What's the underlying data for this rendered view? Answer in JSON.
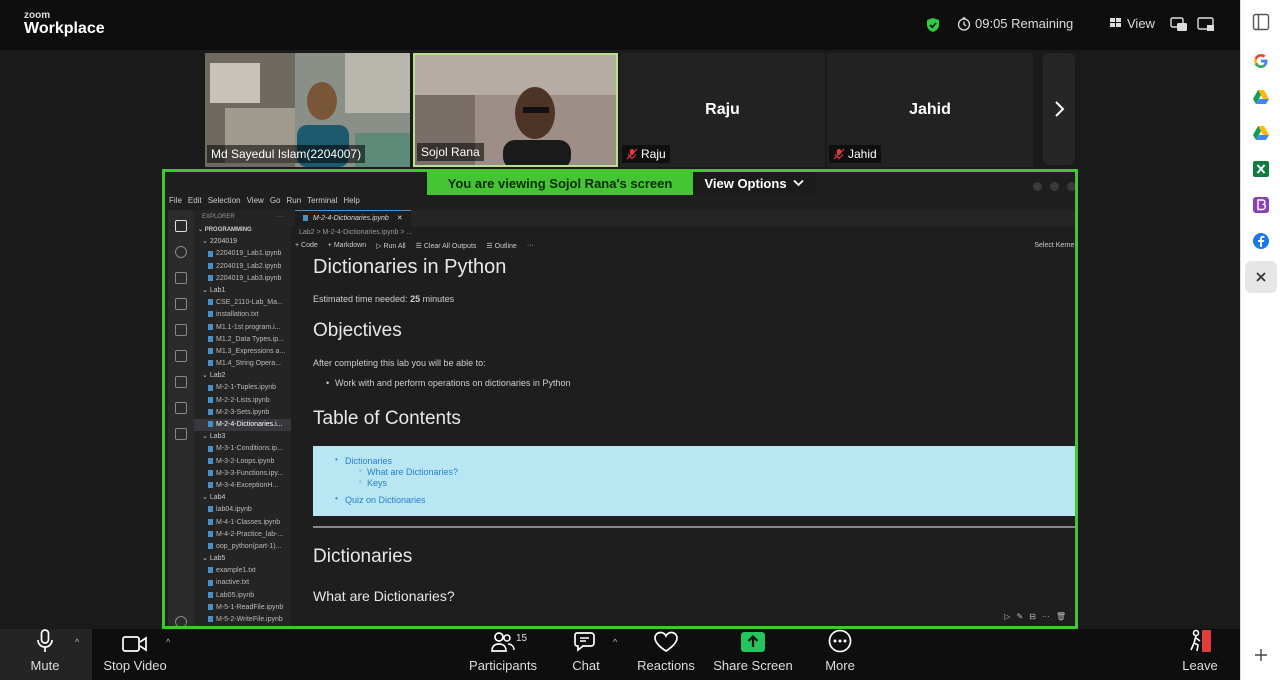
{
  "app": {
    "logo_small": "zoom",
    "logo_big": "Workplace"
  },
  "topbar": {
    "timer": "09:05 Remaining",
    "view_label": "View"
  },
  "participants": [
    {
      "name": "Md Sayedul Islam(2204007)"
    },
    {
      "name": "Sojol Rana"
    },
    {
      "name": "Raju",
      "display": "Raju"
    },
    {
      "name": "Jahid",
      "display": "Jahid"
    }
  ],
  "share": {
    "banner": "You are viewing  Sojol Rana's screen",
    "view_options": "View Options"
  },
  "vscode": {
    "menu": [
      "File",
      "Edit",
      "Selection",
      "View",
      "Go",
      "Run",
      "Terminal",
      "Help"
    ],
    "explorer_title": "EXPLORER",
    "explorer_more": "···",
    "workspace": "PROGRAMMING",
    "tree": [
      {
        "label": "2204019",
        "type": "folder",
        "indent": 1
      },
      {
        "label": "2204019_Lab1.ipynb",
        "type": "file",
        "indent": 2
      },
      {
        "label": "2204019_Lab2.ipynb",
        "type": "file",
        "indent": 2
      },
      {
        "label": "2204019_Lab3.ipynb",
        "type": "file",
        "indent": 2
      },
      {
        "label": "Lab1",
        "type": "folder",
        "indent": 1
      },
      {
        "label": "CSE_2110-Lab_Ma...",
        "type": "file",
        "indent": 2
      },
      {
        "label": "installation.txt",
        "type": "file",
        "indent": 2
      },
      {
        "label": "M1.1-1st program.i...",
        "type": "file",
        "indent": 2
      },
      {
        "label": "M1.2_Data Types.ip...",
        "type": "file",
        "indent": 2
      },
      {
        "label": "M1.3_Expressions a...",
        "type": "file",
        "indent": 2
      },
      {
        "label": "M1.4_String Opera...",
        "type": "file",
        "indent": 2
      },
      {
        "label": "Lab2",
        "type": "folder",
        "indent": 1
      },
      {
        "label": "M-2-1-Tuples.ipynb",
        "type": "file",
        "indent": 2
      },
      {
        "label": "M-2-2-Lists.ipynb",
        "type": "file",
        "indent": 2
      },
      {
        "label": "M-2-3-Sets.ipynb",
        "type": "file",
        "indent": 2
      },
      {
        "label": "M-2-4-Dictionaries.i...",
        "type": "file",
        "indent": 2,
        "selected": true
      },
      {
        "label": "Lab3",
        "type": "folder",
        "indent": 1
      },
      {
        "label": "M-3-1-Conditions.ip...",
        "type": "file",
        "indent": 2
      },
      {
        "label": "M-3-2-Loops.ipynb",
        "type": "file",
        "indent": 2
      },
      {
        "label": "M-3-3-Functions.ipy...",
        "type": "file",
        "indent": 2
      },
      {
        "label": "M-3-4-ExceptionH...",
        "type": "file",
        "indent": 2
      },
      {
        "label": "Lab4",
        "type": "folder",
        "indent": 1
      },
      {
        "label": "lab04.ipynb",
        "type": "file",
        "indent": 2
      },
      {
        "label": "M-4-1-Classes.ipynb",
        "type": "file",
        "indent": 2
      },
      {
        "label": "M-4-2-Practice_lab-...",
        "type": "file",
        "indent": 2
      },
      {
        "label": "oop_python(part-1)...",
        "type": "file",
        "indent": 2
      },
      {
        "label": "Lab5",
        "type": "folder",
        "indent": 1
      },
      {
        "label": "example1.txt",
        "type": "file",
        "indent": 2
      },
      {
        "label": "inactive.txt",
        "type": "file",
        "indent": 2
      },
      {
        "label": "Lab05.ipynb",
        "type": "file",
        "indent": 2
      },
      {
        "label": "M-5-1-ReadFile.ipynb",
        "type": "file",
        "indent": 2
      },
      {
        "label": "M-5-2-WriteFile.ipynb",
        "type": "file",
        "indent": 2
      }
    ],
    "tab": "M-2-4-Dictionaries.ipynb",
    "breadcrumb": "Lab2 > M-2-4-Dictionaries.ipynb > ...",
    "nb_tools": [
      "+ Code",
      "+ Markdown",
      "Run All",
      "Clear All Outputs",
      "Outline",
      "···"
    ],
    "kernel": "Select Kernel",
    "notebook": {
      "title": "Dictionaries in Python",
      "est_prefix": "Estimated time needed:",
      "est_value": "25",
      "est_suffix": "minutes",
      "objectives_h": "Objectives",
      "objectives_p": "After completing this lab you will be able to:",
      "objectives_item": "Work with and perform operations on dictionaries in Python",
      "toc_h": "Table of Contents",
      "toc": [
        "Dictionaries",
        "What are Dictionaries?",
        "Keys",
        "Quiz on Dictionaries"
      ],
      "section_h": "Dictionaries",
      "sub_h": "What are Dictionaries?"
    }
  },
  "controls": {
    "mute": "Mute",
    "stop_video": "Stop Video",
    "participants": "Participants",
    "participants_count": "15",
    "chat": "Chat",
    "reactions": "Reactions",
    "share_screen": "Share Screen",
    "more": "More",
    "leave": "Leave"
  },
  "colors": {
    "accent_green": "#46c534",
    "share_green": "#22c55e",
    "toc_bg": "#b8e6f2"
  }
}
